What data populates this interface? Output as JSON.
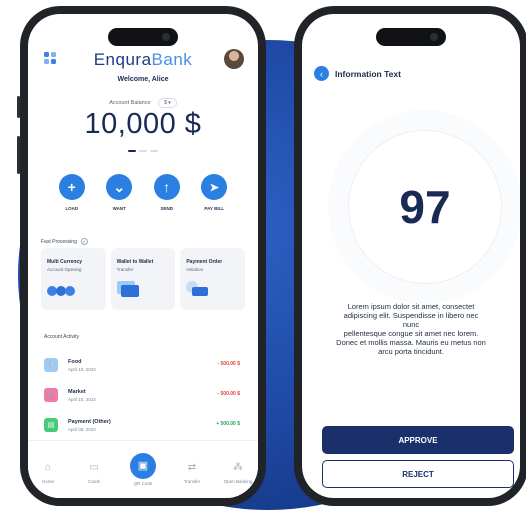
{
  "app": {
    "brand_part1": "Enqura",
    "brand_part2": "Bank",
    "welcome": "Welcome, Alice",
    "balance_label": "Account Balance",
    "currency_pill": "$",
    "balance": "10,000 $"
  },
  "actions": [
    {
      "label": "LOAD",
      "icon": "plus-icon"
    },
    {
      "label": "WANT",
      "icon": "arrow-down-icon"
    },
    {
      "label": "SEND",
      "icon": "arrow-up-icon"
    },
    {
      "label": "PAY BILL",
      "icon": "paper-plane-icon"
    }
  ],
  "fast_processing": {
    "title": "Fast Processing",
    "cards": [
      {
        "title": "Multi Currency",
        "subtitle": "Account Opening"
      },
      {
        "title": "Wallet to Wallet",
        "subtitle": "Transfer"
      },
      {
        "title": "Payment Order",
        "subtitle": "Initiation"
      }
    ]
  },
  "activity": {
    "title": "Account Activity",
    "items": [
      {
        "name": "Food",
        "date": "April 10, 2024",
        "amount": "- 500.00 $",
        "color": "#9ecbf2"
      },
      {
        "name": "Market",
        "date": "April 10, 2024",
        "amount": "- 500.00 $",
        "color": "#f27aa5"
      },
      {
        "name": "Payment (Other)",
        "date": "April 09, 2024",
        "amount": "+ 500.00 $",
        "color": "#49c97a"
      }
    ]
  },
  "tabbar": [
    {
      "label": "Home",
      "icon": "home-icon"
    },
    {
      "label": "Cards",
      "icon": "card-icon"
    },
    {
      "label": "QR Code",
      "icon": "qr-code-icon"
    },
    {
      "label": "Transfer",
      "icon": "transfer-icon"
    },
    {
      "label": "Open Banking",
      "icon": "open-banking-icon"
    }
  ],
  "info": {
    "title": "Information Text",
    "number": "97",
    "text_line1": "Lorem ipsum dolor sit amet, consectet",
    "text_line2": "adipiscing elit. Suspendisse in libero nec",
    "text_line3": "nunc",
    "text_line4": "pellentesque congue sit amet nec lorem.",
    "text_line5": "Donec et mollis massa. Mauris eu metus non",
    "text_line6": "arcu porta tincidunt.",
    "approve": "APPROVE",
    "reject": "REJECT"
  },
  "colors": {
    "accent": "#2b7fe3",
    "navy": "#1b2f6b",
    "background": "#1f4aa6"
  }
}
